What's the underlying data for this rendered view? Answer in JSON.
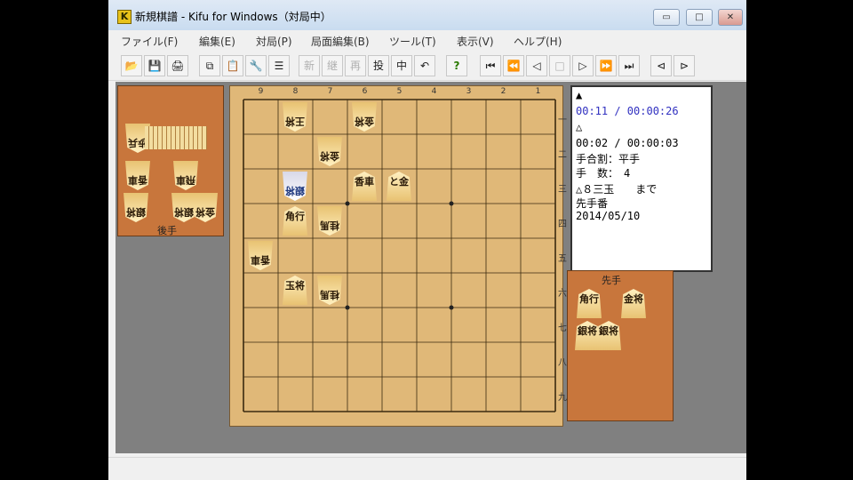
{
  "window": {
    "title": "新規棋譜 - Kifu for Windows（対局中）",
    "app_icon": "K"
  },
  "window_controls": {
    "minimize": "▭",
    "maximize": "□",
    "close": "✕"
  },
  "menu": [
    "ファイル(F)",
    "編集(E)",
    "対局(P)",
    "局面編集(B)",
    "ツール(T)",
    "表示(V)",
    "ヘルプ(H)"
  ],
  "toolbar": {
    "open": "📂",
    "save": "💾",
    "print": "🖨",
    "copy": "⧉",
    "paste": "📋",
    "tool": "🔧",
    "list": "☰",
    "new_game": "新",
    "continue": "継",
    "replay": "再",
    "resign": "投",
    "interrupt": "中",
    "undo": "↶",
    "hint": "?",
    "first": "⏮",
    "fast_back": "⏪",
    "back": "◁",
    "stop": "□",
    "forward": "▷",
    "fast_forward": "⏩",
    "last": "⏭",
    "branch_prev": "⊲",
    "branch_next": "⊳"
  },
  "board": {
    "files": [
      "9",
      "8",
      "7",
      "6",
      "5",
      "4",
      "3",
      "2",
      "1"
    ],
    "ranks": [
      "一",
      "二",
      "三",
      "四",
      "五",
      "六",
      "七",
      "八",
      "九"
    ],
    "pieces": [
      {
        "file": 8,
        "rank": 1,
        "label": "王将",
        "owner": "gote"
      },
      {
        "file": 6,
        "rank": 1,
        "label": "金将",
        "owner": "gote"
      },
      {
        "file": 7,
        "rank": 2,
        "label": "金将",
        "owner": "gote"
      },
      {
        "file": 8,
        "rank": 3,
        "label": "銀将",
        "owner": "gote",
        "selected": true
      },
      {
        "file": 6,
        "rank": 3,
        "label": "香車",
        "owner": "sente"
      },
      {
        "file": 5,
        "rank": 3,
        "label": "と金",
        "owner": "sente"
      },
      {
        "file": 8,
        "rank": 4,
        "label": "角行",
        "owner": "sente"
      },
      {
        "file": 7,
        "rank": 4,
        "label": "桂馬",
        "owner": "gote"
      },
      {
        "file": 9,
        "rank": 5,
        "label": "香車",
        "owner": "gote"
      },
      {
        "file": 8,
        "rank": 6,
        "label": "玉将",
        "owner": "sente"
      },
      {
        "file": 7,
        "rank": 6,
        "label": "桂馬",
        "owner": "gote"
      }
    ]
  },
  "gote_stand": {
    "label": "後手",
    "pieces": [
      "歩兵",
      "香車",
      "飛車",
      "銀将",
      "銀将",
      "金将"
    ]
  },
  "sente_stand": {
    "label": "先手",
    "pieces": [
      "角行",
      "金将",
      "銀将",
      "銀将"
    ]
  },
  "info": {
    "sente_mark": "▲",
    "sente_time": "00:11 / 00:00:26",
    "gote_mark": "△",
    "gote_time": "00:02 / 00:00:03",
    "handicap": "手合割：平手",
    "moves": "手　数：　4",
    "last_move": "△８三玉　　まで",
    "turn": "先手番",
    "date": "2014/05/10"
  }
}
